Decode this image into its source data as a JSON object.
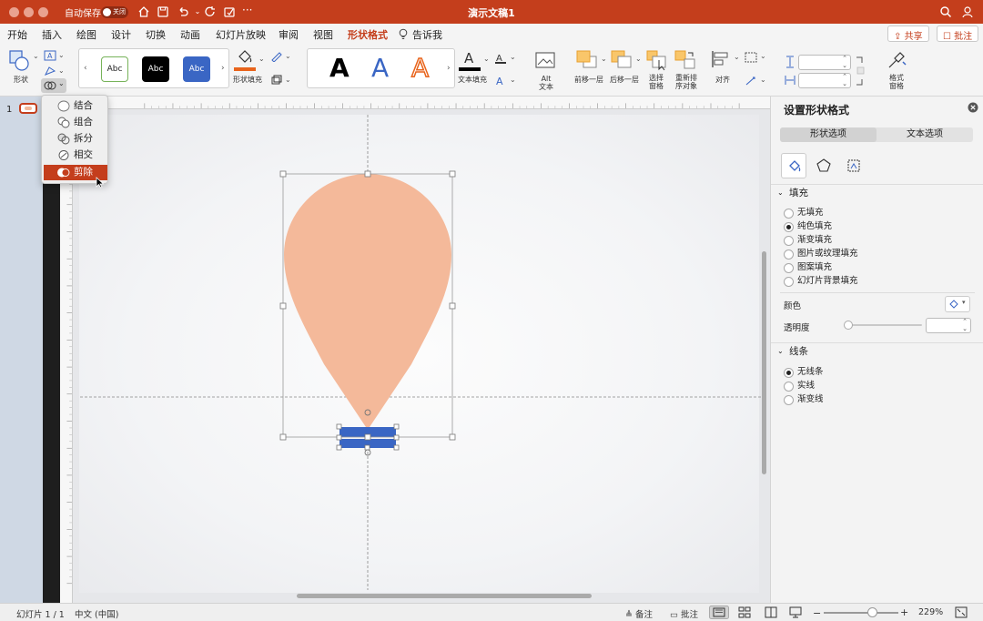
{
  "titlebar": {
    "autosave_label": "自动保存",
    "autosave_state": "关闭",
    "document_title": "演示文稿1",
    "more": "···"
  },
  "menu": {
    "items": [
      "开始",
      "插入",
      "绘图",
      "设计",
      "切换",
      "动画",
      "幻灯片放映",
      "审阅",
      "视图",
      "形状格式",
      "告诉我"
    ],
    "active": "形状格式",
    "share": "共享",
    "comments": "批注"
  },
  "ribbon": {
    "shape_label": "形状",
    "style_samples": [
      "Abc",
      "Abc",
      "Abc"
    ],
    "shape_fill_label": "形状填充",
    "wordart_samples": [
      "A",
      "A",
      "A"
    ],
    "text_fill_label": "文本填充",
    "alt_text_label": "Alt\n文本",
    "bring_forward_label": "前移一层",
    "send_backward_label": "后移一层",
    "selection_pane_label": "选择\n窗格",
    "reorder_label": "重新排\n序对象",
    "align_label": "对齐",
    "format_pane_label": "格式\n窗格",
    "accent_color": "#c43e1c",
    "fill_bar_color": "#e8641c"
  },
  "merge_menu": {
    "items": [
      "结合",
      "组合",
      "拆分",
      "相交",
      "剪除"
    ],
    "selected": "剪除"
  },
  "thumbnail": {
    "slide_number": "1"
  },
  "slide": {
    "balloon_color": "#f4b99a",
    "basket_color": "#3a66c4"
  },
  "format_panel": {
    "title": "设置形状格式",
    "tabs": [
      "形状选项",
      "文本选项"
    ],
    "active_tab": "形状选项",
    "fill_section": "填充",
    "fill_options": [
      "无填充",
      "纯色填充",
      "渐变填充",
      "图片或纹理填充",
      "图案填充",
      "幻灯片背景填充"
    ],
    "fill_selected": "纯色填充",
    "color_label": "颜色",
    "transparency_label": "透明度",
    "line_section": "线条",
    "line_options": [
      "无线条",
      "实线",
      "渐变线"
    ],
    "line_selected": "无线条"
  },
  "statusbar": {
    "slide_info": "幻灯片 1 / 1",
    "language": "中文 (中国)",
    "notes": "备注",
    "comments": "批注",
    "zoom": "229%"
  }
}
